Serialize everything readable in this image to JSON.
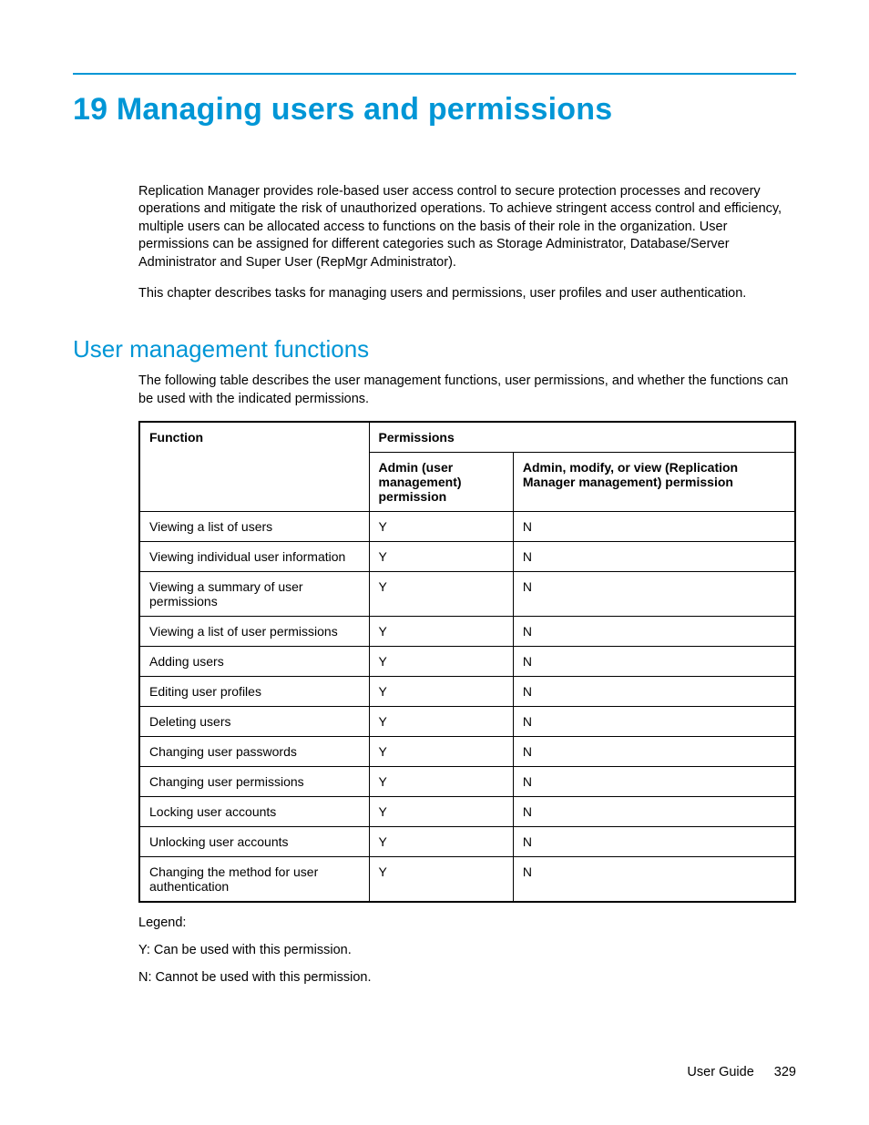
{
  "chapter_title": "19 Managing users and permissions",
  "intro_paragraph": "Replication Manager provides role-based user access control to secure protection processes and recovery operations and mitigate the risk of unauthorized operations. To achieve stringent access control and efficiency, multiple users can be allocated access to functions on the basis of their role in the organization. User permissions can be assigned for different categories such as Storage Administrator, Database/Server Administrator and Super User (RepMgr Administrator).",
  "intro_paragraph2": "This chapter describes tasks for managing users and permissions, user profiles and user authentication.",
  "section_title": "User management functions",
  "section_intro": "The following table describes the user management functions, user permissions, and whether the functions can be used with the indicated permissions.",
  "table": {
    "header_function": "Function",
    "header_permissions": "Permissions",
    "header_admin": "Admin (user management) permission",
    "header_amv": "Admin, modify, or view (Replication Manager management) permission",
    "rows": [
      {
        "func": "Viewing a list of users",
        "admin": "Y",
        "amv": "N"
      },
      {
        "func": "Viewing individual user information",
        "admin": "Y",
        "amv": "N"
      },
      {
        "func": "Viewing a summary of user permissions",
        "admin": "Y",
        "amv": "N"
      },
      {
        "func": "Viewing a list of user permissions",
        "admin": "Y",
        "amv": "N"
      },
      {
        "func": "Adding users",
        "admin": "Y",
        "amv": "N"
      },
      {
        "func": "Editing user profiles",
        "admin": "Y",
        "amv": "N"
      },
      {
        "func": "Deleting users",
        "admin": "Y",
        "amv": "N"
      },
      {
        "func": "Changing user passwords",
        "admin": "Y",
        "amv": "N"
      },
      {
        "func": "Changing user permissions",
        "admin": "Y",
        "amv": "N"
      },
      {
        "func": "Locking user accounts",
        "admin": "Y",
        "amv": "N"
      },
      {
        "func": "Unlocking user accounts",
        "admin": "Y",
        "amv": "N"
      },
      {
        "func": "Changing the method for user authentication",
        "admin": "Y",
        "amv": "N"
      }
    ]
  },
  "legend_label": "Legend:",
  "legend_y": "Y: Can be used with this permission.",
  "legend_n": "N: Cannot be used with this permission.",
  "footer_title": "User Guide",
  "footer_page": "329"
}
